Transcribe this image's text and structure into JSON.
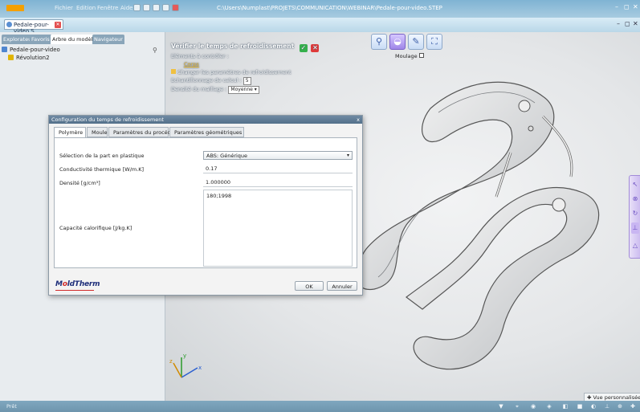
{
  "titlebar": {
    "menu": [
      "Fichier",
      "Edition",
      "Fenêtre",
      "Aide"
    ],
    "path": "C:\\Users\\Numplast\\PROJETS\\COMMUNICATION\\WEBINAR\\Pedale-pour-video.STEP",
    "window_controls": [
      "–",
      "◻",
      "✕"
    ]
  },
  "doctab": {
    "label": "Pedale-pour-video.S...",
    "icon": "document-icon",
    "close_icon": "close-icon"
  },
  "doc_window_controls": [
    "–",
    "◻",
    "✕"
  ],
  "left_panel": {
    "tabs": [
      {
        "label": "Explorateur",
        "active": false
      },
      {
        "label": "Favoris",
        "active": false
      },
      {
        "label": "Arbre du modèle",
        "active": true
      },
      {
        "label": "Navigateur",
        "active": false
      }
    ],
    "search_icon": "search-icon",
    "tree": [
      {
        "label": "Pedale-pour-video",
        "icon": "part-icon",
        "color": "#4f86cf",
        "indent": 0
      },
      {
        "label": "Révolution2",
        "icon": "revolution-icon",
        "color": "#e0b400",
        "indent": 1
      }
    ]
  },
  "mold_toolbar": {
    "buttons": [
      {
        "icon": "magnify-icon",
        "glyph": "🔍︎",
        "active": false
      },
      {
        "icon": "mold-icon",
        "glyph": "◒",
        "active": true
      },
      {
        "icon": "edit-icon",
        "glyph": "✎",
        "active": false
      },
      {
        "icon": "grid-icon",
        "glyph": "⛶",
        "active": false
      }
    ],
    "label": "Moulage"
  },
  "verify": {
    "title": "Vérifier le temps de refroidissement",
    "elements_label": "Eléments à contrôler :",
    "corps_label": "Corps",
    "change_params": "Changer les paramètres de refroidissement",
    "sampling_label": "Echantillonnage de calcul :",
    "sampling_value": "5",
    "mesh_label": "Densité du maillage :",
    "mesh_value": "Moyenne"
  },
  "dialog": {
    "title": "Configuration du temps de refroidissement",
    "close": "x",
    "tabs": [
      {
        "label": "Polymère",
        "active": true
      },
      {
        "label": "Moule",
        "active": false
      },
      {
        "label": "Paramètres du procédé",
        "active": false
      },
      {
        "label": "Paramètres géométriques",
        "active": false
      }
    ],
    "fields": {
      "plastic_label": "Sélection de la part en plastique",
      "plastic_value": "ABS: Générique",
      "conductivity_label": "Conductivité thermique [W/m.K]",
      "conductivity_value": "0.17",
      "density_label": "Densité [g/cm³]",
      "density_value": "1.000000",
      "heat_label": "Capacité calorifique [J/kg.K]",
      "heat_value": "180;1998"
    },
    "logo": "MoldTherm",
    "ok_label": "OK",
    "cancel_label": "Annuler"
  },
  "right_tools": [
    {
      "icon": "cursor-icon",
      "glyph": "↖"
    },
    {
      "icon": "circle-target-icon",
      "glyph": "⊗"
    },
    {
      "icon": "refresh-icon",
      "glyph": "↻"
    },
    {
      "icon": "pin-icon",
      "glyph": "⊥"
    },
    {
      "icon": "shape-icon",
      "glyph": "△"
    }
  ],
  "view_label": "Vue personnalisée",
  "status": {
    "text": "Prêt"
  },
  "axis": {
    "x": "x",
    "y": "y",
    "z": "z"
  }
}
